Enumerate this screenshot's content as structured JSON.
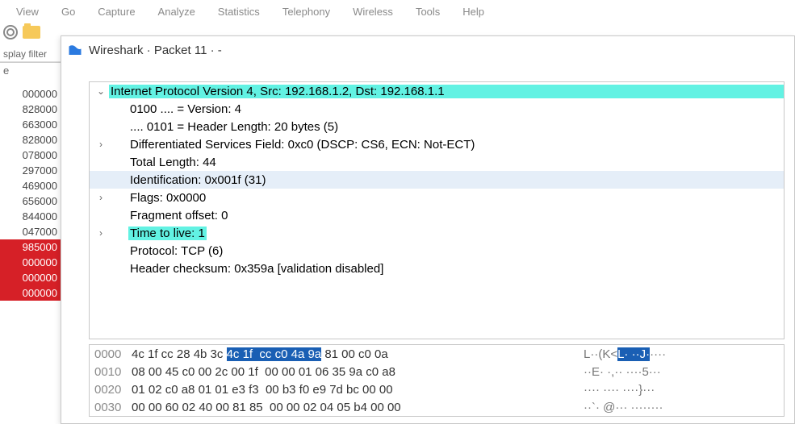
{
  "menu": {
    "items": [
      "View",
      "Go",
      "Capture",
      "Analyze",
      "Statistics",
      "Telephony",
      "Wireless",
      "Tools",
      "Help"
    ]
  },
  "toolbar": {
    "gear": "settings-gear",
    "folder": "folder"
  },
  "left": {
    "filter_label": "splay filter",
    "e_label": "e",
    "rows": [
      {
        "t": "000000",
        "sel": false
      },
      {
        "t": "828000",
        "sel": false
      },
      {
        "t": "663000",
        "sel": false
      },
      {
        "t": "828000",
        "sel": false
      },
      {
        "t": "078000",
        "sel": false
      },
      {
        "t": "297000",
        "sel": false
      },
      {
        "t": "469000",
        "sel": false
      },
      {
        "t": "656000",
        "sel": false
      },
      {
        "t": "844000",
        "sel": false
      },
      {
        "t": "047000",
        "sel": false
      },
      {
        "t": "985000",
        "sel": true
      },
      {
        "t": "000000",
        "sel": true
      },
      {
        "t": "000000",
        "sel": true
      },
      {
        "t": "000000",
        "sel": true
      }
    ]
  },
  "dialog": {
    "title": "Wireshark · Packet 11 · -"
  },
  "tree": {
    "rows": [
      {
        "arrow": "v",
        "indent": 0,
        "text": "Internet Protocol Version 4, Src: 192.168.1.2, Dst: 192.168.1.1",
        "hl": "cyan-full"
      },
      {
        "arrow": "",
        "indent": 1,
        "text": "0100 .... = Version: 4",
        "hl": ""
      },
      {
        "arrow": "",
        "indent": 1,
        "text": ".... 0101 = Header Length: 20 bytes (5)",
        "hl": ""
      },
      {
        "arrow": ">",
        "indent": 1,
        "text": "Differentiated Services Field: 0xc0 (DSCP: CS6, ECN: Not-ECT)",
        "hl": ""
      },
      {
        "arrow": "",
        "indent": 1,
        "text": "Total Length: 44",
        "hl": ""
      },
      {
        "arrow": "",
        "indent": 1,
        "text": "Identification: 0x001f (31)",
        "hl": "blue"
      },
      {
        "arrow": ">",
        "indent": 1,
        "text": "Flags: 0x0000",
        "hl": ""
      },
      {
        "arrow": "",
        "indent": 1,
        "text": "Fragment offset: 0",
        "hl": ""
      },
      {
        "arrow": ">",
        "indent": 1,
        "text": "Time to live: 1",
        "hl": "cyan"
      },
      {
        "arrow": "",
        "indent": 1,
        "text": "Protocol: TCP (6)",
        "hl": ""
      },
      {
        "arrow": "",
        "indent": 1,
        "text": "Header checksum: 0x359a [validation disabled]",
        "hl": ""
      }
    ]
  },
  "hex": {
    "rows": [
      {
        "off": "0000",
        "pre": "4c 1f cc 28 4b 3c ",
        "sel": "4c 1f  cc c0 4a 9a",
        "post": " 81 00 c0 0a   ",
        "apre": "L··(K<",
        "asel": "L· ··J·",
        "apost": "····"
      },
      {
        "off": "0010",
        "pre": "08 00 45 c0 00 2c 00 1f  00 00 01 06 35 9a c0 a8   ",
        "sel": "",
        "post": "",
        "apre": "··E· ·,·· ····5···",
        "asel": "",
        "apost": ""
      },
      {
        "off": "0020",
        "pre": "01 02 c0 a8 01 01 e3 f3  00 b3 f0 e9 7d bc 00 00   ",
        "sel": "",
        "post": "",
        "apre": "···· ···· ····}···",
        "asel": "",
        "apost": ""
      },
      {
        "off": "0030",
        "pre": "00 00 60 02 40 00 81 85  00 00 02 04 05 b4 00 00   ",
        "sel": "",
        "post": "",
        "apre": "··`· @··· ········",
        "asel": "",
        "apost": ""
      }
    ]
  }
}
